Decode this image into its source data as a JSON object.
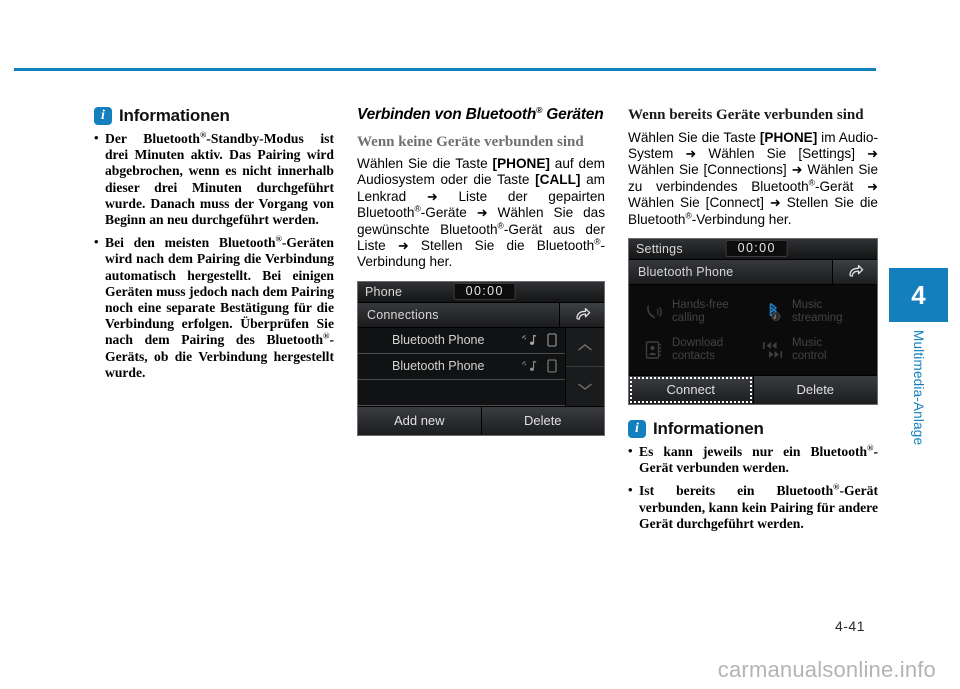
{
  "page": {
    "number": "4-41",
    "watermark": "carmanualsonline.info",
    "chapter_number": "4",
    "chapter_label": "Multimedia-Anlage",
    "accent_color": "#1380bd"
  },
  "column_left": {
    "info_box": {
      "icon": "info-icon",
      "icon_letter": "i",
      "title": "Informationen",
      "items": [
        "Der Bluetooth®-Standby-Modus ist drei Minuten aktiv. Das Pairing wird abgebrochen, wenn es nicht innerhalb dieser drei Minuten durchgeführt wurde. Danach muss der Vorgang von Beginn an neu durchgeführt werden.",
        "Bei den meisten Bluetooth®-Geräten wird nach dem Pairing die Verbindung automatisch hergestellt. Bei einigen Geräten muss jedoch nach dem Pairing noch eine separate Bestätigung für die Verbindung erfolgen. Überprüfen Sie nach dem Pairing des Bluetooth®-Geräts, ob die Verbindung hergestellt wurde."
      ]
    }
  },
  "column_middle": {
    "heading": "Verbinden von Bluetooth® Geräten",
    "subheading": "Wenn keine Geräte verbunden sind",
    "body": "Wählen Sie die Taste [PHONE] auf dem Audiosystem oder die Taste [CALL] am Lenkrad ➡ Liste der gepairten Bluetooth®-Geräte ➡ Wählen Sie das gewünschte Bluetooth®-Gerät aus der Liste ➡ Stellen Sie die Bluetooth®-Verbindung her.",
    "screenshot": {
      "name": "connections-screen",
      "status_title": "Phone",
      "clock": "00:00",
      "screen_title": "Connections",
      "back_icon": "back-arrow-icon",
      "rows": [
        {
          "label": "Bluetooth Phone",
          "icons": [
            "music-streaming-icon",
            "phone-device-icon"
          ]
        },
        {
          "label": "Bluetooth Phone",
          "icons": [
            "music-streaming-icon",
            "phone-device-icon"
          ]
        },
        {
          "label": "",
          "icons": []
        }
      ],
      "scroll_up_icon": "chevron-up-icon",
      "scroll_down_icon": "chevron-down-icon",
      "buttons": [
        {
          "label": "Add new",
          "focused": false
        },
        {
          "label": "Delete",
          "focused": false
        }
      ]
    }
  },
  "column_right": {
    "subheading": "Wenn bereits Geräte verbunden sind",
    "body": "Wählen Sie die Taste [PHONE] im Audio-System ➡ Wählen Sie [Settings] ➡ Wählen Sie [Connections] ➡ Wählen Sie zu verbindendes Bluetooth®-Gerät ➡ Wählen Sie [Connect] ➡ Stellen Sie die Bluetooth®-Verbindung her.",
    "screenshot": {
      "name": "bluetooth-phone-settings-screen",
      "status_title": "Settings",
      "clock": "00:00",
      "screen_title": "Bluetooth Phone",
      "back_icon": "back-arrow-icon",
      "features": [
        {
          "icon": "handsfree-calling-icon",
          "line1": "Hands-free",
          "line2": "calling"
        },
        {
          "icon": "music-streaming-icon",
          "line1": "Music",
          "line2": "streaming"
        },
        {
          "icon": "download-contacts-icon",
          "line1": "Download",
          "line2": "contacts"
        },
        {
          "icon": "music-control-icon",
          "line1": "Music",
          "line2": "control"
        }
      ],
      "buttons": [
        {
          "label": "Connect",
          "focused": true
        },
        {
          "label": "Delete",
          "focused": false
        }
      ]
    },
    "info_box": {
      "icon": "info-icon",
      "icon_letter": "i",
      "title": "Informationen",
      "items": [
        "Es kann jeweils nur ein Bluetooth®-Gerät verbunden werden.",
        "Ist bereits ein Bluetooth®-Gerät verbunden, kann kein Pairing für andere Gerät durchgeführt werden."
      ]
    }
  }
}
